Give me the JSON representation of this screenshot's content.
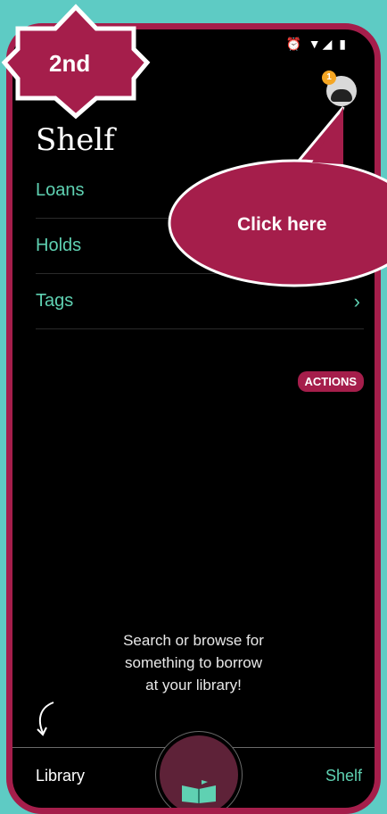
{
  "step_badge": "2nd",
  "callout": "Click here",
  "status_icons": "⏰ ▼◢ ▮",
  "profile": {
    "notification_count": "1"
  },
  "page_title": "Shelf",
  "menu": [
    {
      "label": "Loans",
      "chevron": ""
    },
    {
      "label": "Holds",
      "chevron": ""
    },
    {
      "label": "Tags",
      "chevron": "›"
    }
  ],
  "actions_label": "ACTIONS",
  "empty_message": "Search or browse for\nsomething to borrow\nat your library!",
  "nav": {
    "left_label": "Library",
    "right_label": "Shelf"
  },
  "colors": {
    "accent": "#a51e4b",
    "teal": "#5fd1b2",
    "background": "#5ecbc4"
  }
}
